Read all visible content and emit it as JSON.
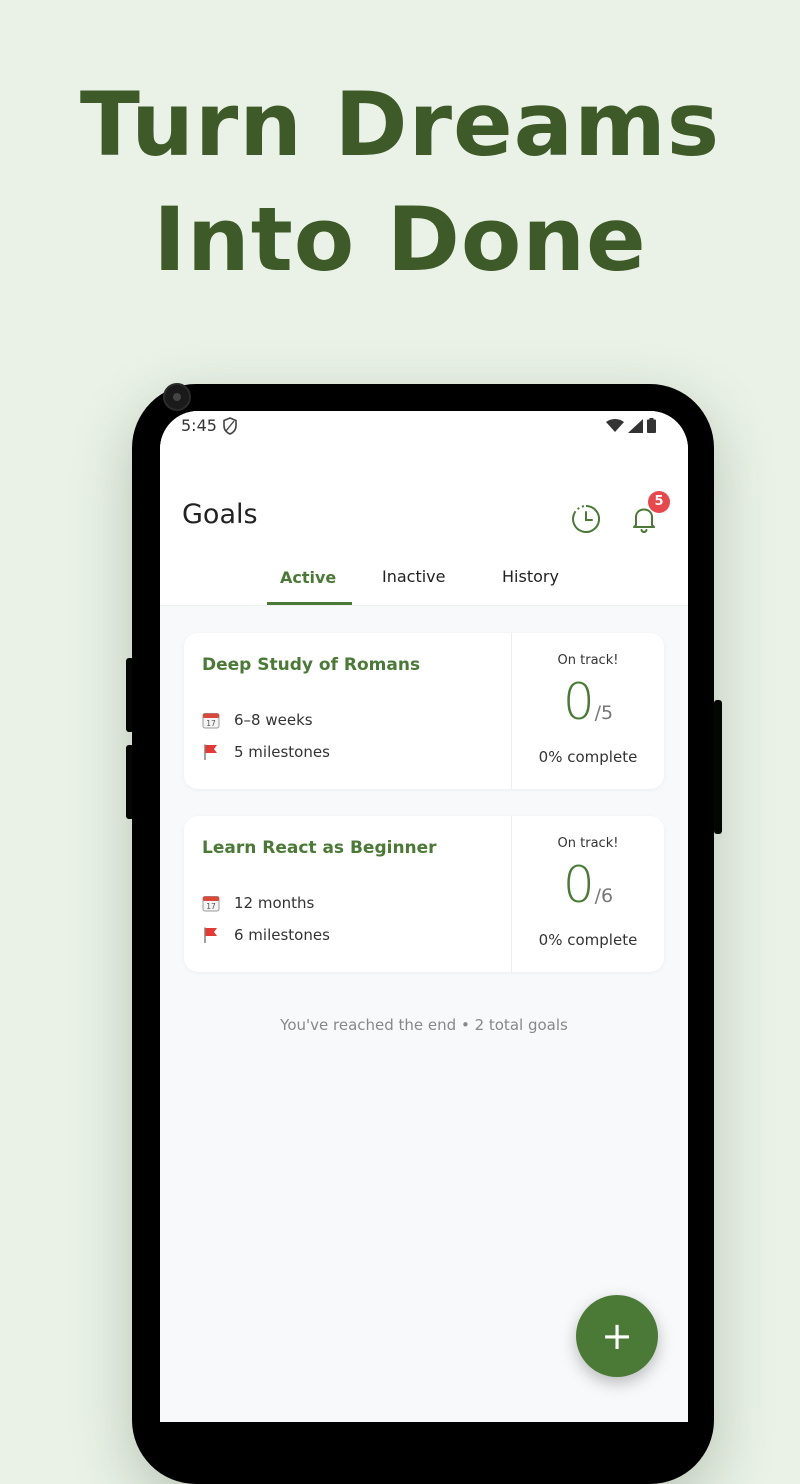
{
  "headline": {
    "line1": "Turn Dreams",
    "line2": "Into Done"
  },
  "status_bar": {
    "time": "5:45"
  },
  "header": {
    "title": "Goals",
    "notification_count": "5"
  },
  "tabs": [
    {
      "label": "Active",
      "selected": true
    },
    {
      "label": "Inactive",
      "selected": false
    },
    {
      "label": "History",
      "selected": false
    }
  ],
  "goals": [
    {
      "title": "Deep Study of Romans",
      "duration": "6–8 weeks",
      "milestones": "5 milestones",
      "status": "On track!",
      "done": "0",
      "total": "/5",
      "complete": "0% complete"
    },
    {
      "title": "Learn React as Beginner",
      "duration": "12 months",
      "milestones": "6 milestones",
      "status": "On track!",
      "done": "0",
      "total": "/6",
      "complete": "0% complete"
    }
  ],
  "list_footer": "You've reached the end • 2 total goals",
  "fab": {
    "label": "+"
  },
  "colors": {
    "background": "#eaf2e7",
    "brand_green": "#4a7a35",
    "headline_green": "#3e5a28",
    "badge_red": "#e8474c"
  },
  "icons": {
    "history": "history-clock-icon",
    "notifications": "bell-icon",
    "duration": "calendar-icon",
    "milestones": "flag-icon",
    "add": "plus-icon"
  }
}
